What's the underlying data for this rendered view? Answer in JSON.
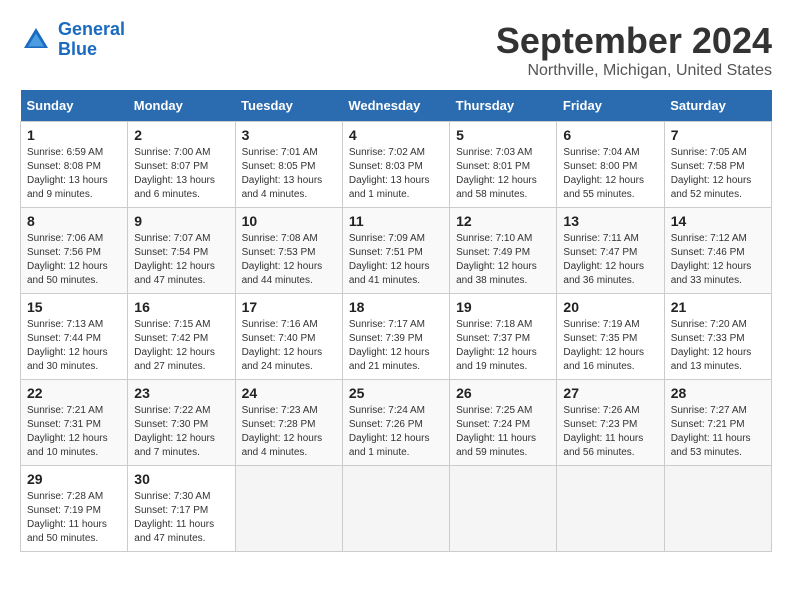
{
  "header": {
    "logo_line1": "General",
    "logo_line2": "Blue",
    "title": "September 2024",
    "subtitle": "Northville, Michigan, United States"
  },
  "days_of_week": [
    "Sunday",
    "Monday",
    "Tuesday",
    "Wednesday",
    "Thursday",
    "Friday",
    "Saturday"
  ],
  "weeks": [
    [
      {
        "day": 1,
        "sunrise": "6:59 AM",
        "sunset": "8:08 PM",
        "daylight": "13 hours and 9 minutes."
      },
      {
        "day": 2,
        "sunrise": "7:00 AM",
        "sunset": "8:07 PM",
        "daylight": "13 hours and 6 minutes."
      },
      {
        "day": 3,
        "sunrise": "7:01 AM",
        "sunset": "8:05 PM",
        "daylight": "13 hours and 4 minutes."
      },
      {
        "day": 4,
        "sunrise": "7:02 AM",
        "sunset": "8:03 PM",
        "daylight": "13 hours and 1 minute."
      },
      {
        "day": 5,
        "sunrise": "7:03 AM",
        "sunset": "8:01 PM",
        "daylight": "12 hours and 58 minutes."
      },
      {
        "day": 6,
        "sunrise": "7:04 AM",
        "sunset": "8:00 PM",
        "daylight": "12 hours and 55 minutes."
      },
      {
        "day": 7,
        "sunrise": "7:05 AM",
        "sunset": "7:58 PM",
        "daylight": "12 hours and 52 minutes."
      }
    ],
    [
      {
        "day": 8,
        "sunrise": "7:06 AM",
        "sunset": "7:56 PM",
        "daylight": "12 hours and 50 minutes."
      },
      {
        "day": 9,
        "sunrise": "7:07 AM",
        "sunset": "7:54 PM",
        "daylight": "12 hours and 47 minutes."
      },
      {
        "day": 10,
        "sunrise": "7:08 AM",
        "sunset": "7:53 PM",
        "daylight": "12 hours and 44 minutes."
      },
      {
        "day": 11,
        "sunrise": "7:09 AM",
        "sunset": "7:51 PM",
        "daylight": "12 hours and 41 minutes."
      },
      {
        "day": 12,
        "sunrise": "7:10 AM",
        "sunset": "7:49 PM",
        "daylight": "12 hours and 38 minutes."
      },
      {
        "day": 13,
        "sunrise": "7:11 AM",
        "sunset": "7:47 PM",
        "daylight": "12 hours and 36 minutes."
      },
      {
        "day": 14,
        "sunrise": "7:12 AM",
        "sunset": "7:46 PM",
        "daylight": "12 hours and 33 minutes."
      }
    ],
    [
      {
        "day": 15,
        "sunrise": "7:13 AM",
        "sunset": "7:44 PM",
        "daylight": "12 hours and 30 minutes."
      },
      {
        "day": 16,
        "sunrise": "7:15 AM",
        "sunset": "7:42 PM",
        "daylight": "12 hours and 27 minutes."
      },
      {
        "day": 17,
        "sunrise": "7:16 AM",
        "sunset": "7:40 PM",
        "daylight": "12 hours and 24 minutes."
      },
      {
        "day": 18,
        "sunrise": "7:17 AM",
        "sunset": "7:39 PM",
        "daylight": "12 hours and 21 minutes."
      },
      {
        "day": 19,
        "sunrise": "7:18 AM",
        "sunset": "7:37 PM",
        "daylight": "12 hours and 19 minutes."
      },
      {
        "day": 20,
        "sunrise": "7:19 AM",
        "sunset": "7:35 PM",
        "daylight": "12 hours and 16 minutes."
      },
      {
        "day": 21,
        "sunrise": "7:20 AM",
        "sunset": "7:33 PM",
        "daylight": "12 hours and 13 minutes."
      }
    ],
    [
      {
        "day": 22,
        "sunrise": "7:21 AM",
        "sunset": "7:31 PM",
        "daylight": "12 hours and 10 minutes."
      },
      {
        "day": 23,
        "sunrise": "7:22 AM",
        "sunset": "7:30 PM",
        "daylight": "12 hours and 7 minutes."
      },
      {
        "day": 24,
        "sunrise": "7:23 AM",
        "sunset": "7:28 PM",
        "daylight": "12 hours and 4 minutes."
      },
      {
        "day": 25,
        "sunrise": "7:24 AM",
        "sunset": "7:26 PM",
        "daylight": "12 hours and 1 minute."
      },
      {
        "day": 26,
        "sunrise": "7:25 AM",
        "sunset": "7:24 PM",
        "daylight": "11 hours and 59 minutes."
      },
      {
        "day": 27,
        "sunrise": "7:26 AM",
        "sunset": "7:23 PM",
        "daylight": "11 hours and 56 minutes."
      },
      {
        "day": 28,
        "sunrise": "7:27 AM",
        "sunset": "7:21 PM",
        "daylight": "11 hours and 53 minutes."
      }
    ],
    [
      {
        "day": 29,
        "sunrise": "7:28 AM",
        "sunset": "7:19 PM",
        "daylight": "11 hours and 50 minutes."
      },
      {
        "day": 30,
        "sunrise": "7:30 AM",
        "sunset": "7:17 PM",
        "daylight": "11 hours and 47 minutes."
      },
      null,
      null,
      null,
      null,
      null
    ]
  ]
}
